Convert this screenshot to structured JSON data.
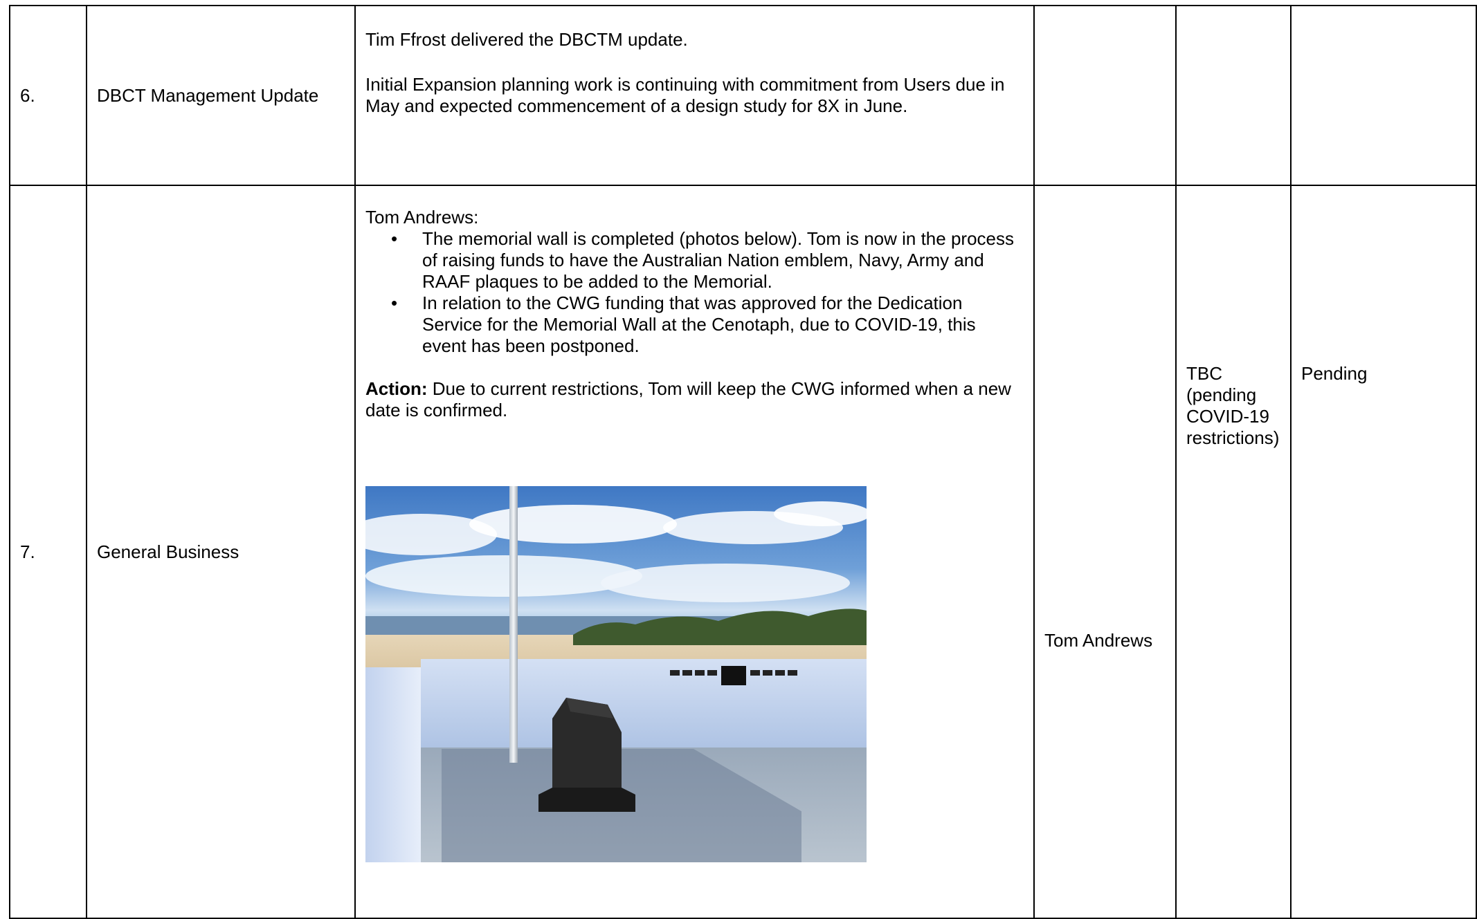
{
  "rows": [
    {
      "number": "6.",
      "topic": "DBCT Management Update",
      "paragraphs": [
        "Tim Ffrost delivered the DBCTM update.",
        "Initial Expansion planning work is continuing with commitment from Users due in May and expected commencement of a design study for 8X in June."
      ],
      "responsible": "",
      "due": "",
      "status": ""
    },
    {
      "number": "7.",
      "topic": "General Business",
      "intro": "Tom Andrews:",
      "bullets": [
        "The memorial wall is completed (photos below). Tom is now in the process of raising funds to have the Australian Nation emblem, Navy, Army and RAAF plaques to be added to the Memorial.",
        "In relation to the CWG funding that was approved for the Dedication Service for the Memorial Wall at the Cenotaph, due to COVID-19, this event has been postponed."
      ],
      "action_label": "Action:",
      "action_text": " Due to current restrictions, Tom will keep the CWG informed when a new date is confirmed.",
      "responsible": "Tom Andrews",
      "due": "TBC (pending COVID-19 restrictions)",
      "status": "Pending"
    }
  ]
}
